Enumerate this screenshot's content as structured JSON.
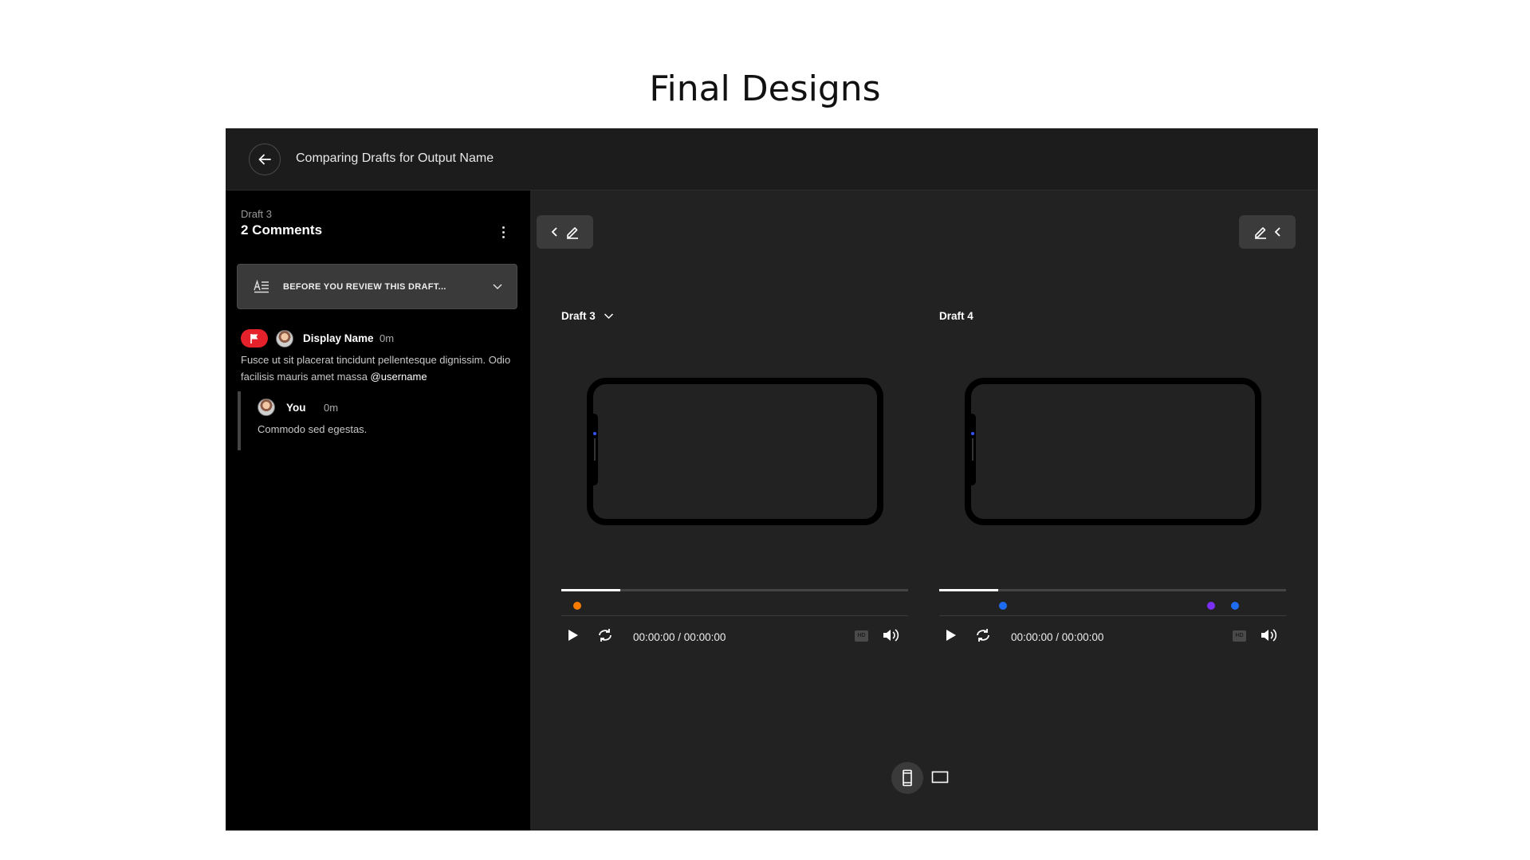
{
  "page": {
    "title": "Final Designs"
  },
  "topbar": {
    "title": "Comparing Drafts for Output Name",
    "back_icon": "arrow-left-icon"
  },
  "sidebar": {
    "draft_label": "Draft 3",
    "comments_count": "2 Comments",
    "review_banner": {
      "label": "BEFORE YOU REVIEW THIS DRAFT...",
      "icon": "notes-icon"
    },
    "comment": {
      "author": "Display Name",
      "time": "0m",
      "body_text": "Fusce ut sit placerat tincidunt pellentesque dignissim. Odio facilisis mauris amet massa ",
      "mention": "@username",
      "flag_color": "#e5222b"
    },
    "reply": {
      "author": "You",
      "time": "0m",
      "body": "Commodo sed egestas."
    }
  },
  "panels": [
    {
      "title": "Draft 3",
      "has_dropdown": true,
      "progress": 0.17,
      "markers": [
        {
          "color": "#f57c00",
          "position": 0.045
        }
      ],
      "timecode": "00:00:00 / 00:00:00",
      "hd_label": "HD"
    },
    {
      "title": "Draft 4",
      "has_dropdown": false,
      "progress": 0.17,
      "markers": [
        {
          "color": "#1e6cf2",
          "position": 0.185
        },
        {
          "color": "#7b2ff2",
          "position": 0.785
        },
        {
          "color": "#1e6cf2",
          "position": 0.852
        }
      ],
      "timecode": "00:00:00 / 00:00:00",
      "hd_label": "HD"
    }
  ],
  "colors": {
    "app_bg": "#222222",
    "sidebar_bg": "#000000",
    "accent_flag": "#e5222b"
  }
}
